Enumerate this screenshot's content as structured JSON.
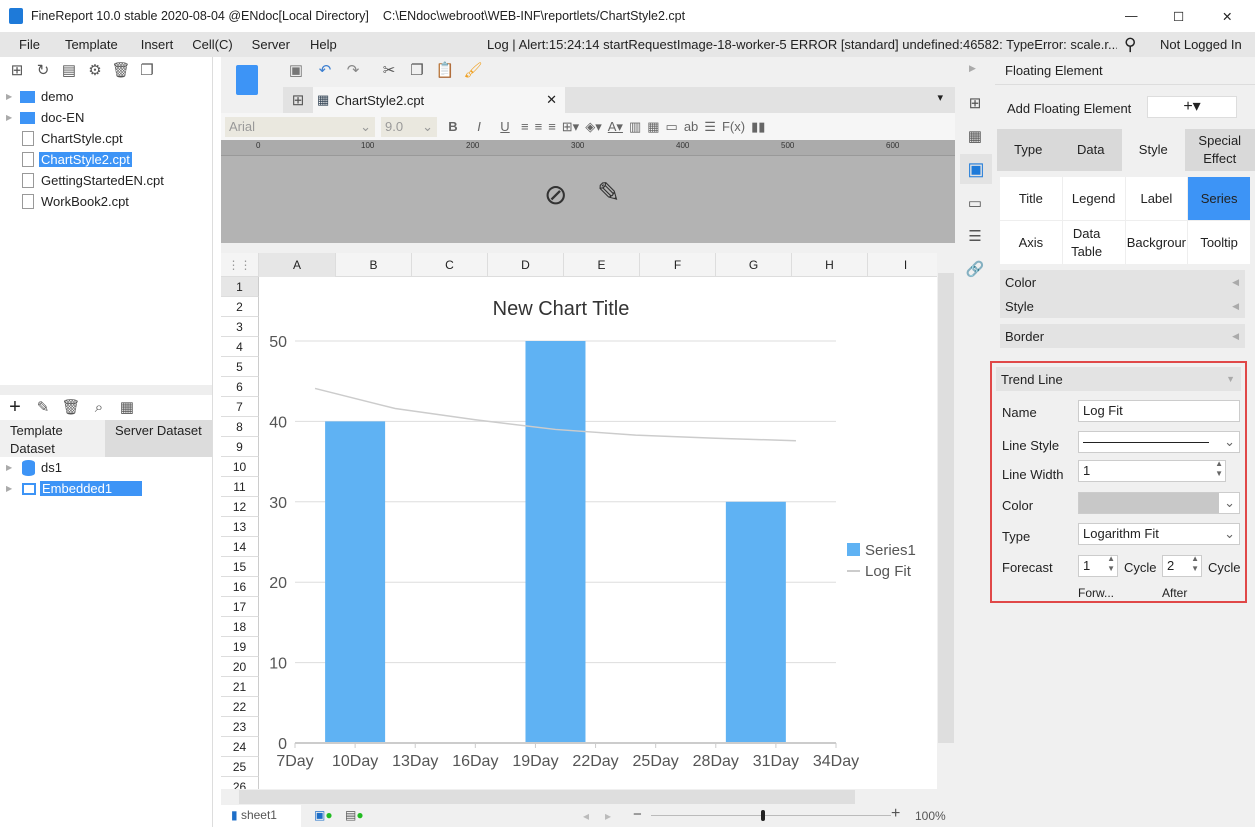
{
  "window": {
    "title": "FineReport 10.0 stable 2020-08-04 @ENdoc[Local Directory]",
    "path": "C:\\ENdoc\\webroot\\WEB-INF\\reportlets/ChartStyle2.cpt",
    "minimize": "—",
    "maximize": "☐",
    "close": "✕"
  },
  "menu": [
    "File",
    "Template",
    "Insert",
    "Cell(C)",
    "Server",
    "Help"
  ],
  "log": "Log | Alert:15:24:14 startRequestImage-18-worker-5 ERROR [standard] undefined:46582: TypeError: scale.r...",
  "login": "Not Logged In",
  "tree": [
    {
      "label": "demo",
      "type": "folder"
    },
    {
      "label": "doc-EN",
      "type": "folder"
    },
    {
      "label": "ChartStyle.cpt",
      "type": "file"
    },
    {
      "label": "ChartStyle2.cpt",
      "type": "file",
      "selected": true
    },
    {
      "label": "GettingStartedEN.cpt",
      "type": "file"
    },
    {
      "label": "WorkBook2.cpt",
      "type": "file"
    }
  ],
  "dataset_tabs": {
    "template": "Template Dataset",
    "server": "Server Dataset"
  },
  "datasets": [
    {
      "label": "ds1"
    },
    {
      "label": "Embedded1",
      "selected": true
    }
  ],
  "file_tab": "ChartStyle2.cpt",
  "format": {
    "font": "Arial",
    "size": "9.0"
  },
  "ruler": [
    "0",
    "100",
    "200",
    "300",
    "400",
    "500",
    "600"
  ],
  "columns": [
    "A",
    "B",
    "C",
    "D",
    "E",
    "F",
    "G",
    "H",
    "I"
  ],
  "rows": [
    "1",
    "2",
    "3",
    "4",
    "5",
    "6",
    "7",
    "8",
    "9",
    "10",
    "11",
    "12",
    "13",
    "14",
    "15",
    "16",
    "17",
    "18",
    "19",
    "20",
    "21",
    "22",
    "23",
    "24",
    "25",
    "26"
  ],
  "sheet": "sheet1",
  "zoom": "100%",
  "zoom_level": 100,
  "chart_data": {
    "type": "bar",
    "title": "New Chart Title",
    "x_ticks": [
      "7Day",
      "10Day",
      "13Day",
      "16Day",
      "19Day",
      "22Day",
      "25Day",
      "28Day",
      "31Day",
      "34Day"
    ],
    "x_range": [
      7,
      34
    ],
    "y_ticks": [
      "0",
      "10",
      "20",
      "30",
      "40",
      "50"
    ],
    "ylim": [
      0,
      50
    ],
    "grid": true,
    "legend_position": "right",
    "series": [
      {
        "name": "Series1",
        "x": [
          10,
          20,
          30
        ],
        "values": [
          40,
          50,
          30
        ],
        "color": "#5fb2f3"
      }
    ],
    "trend_line": {
      "name": "Log Fit",
      "color": "#cccccc",
      "x": [
        8,
        12,
        16,
        20,
        24,
        28,
        32
      ],
      "values": [
        44.1,
        41.6,
        40.2,
        39.0,
        38.3,
        37.9,
        37.6
      ]
    }
  },
  "panel": {
    "header": "Floating Element",
    "add_label": "Add Floating Element",
    "add_btn": "+▾",
    "tabs": [
      "Type",
      "Data",
      "Style",
      "Special Effect"
    ],
    "active_tab": "Style",
    "subtabs": [
      "Title",
      "Legend",
      "Label",
      "Series",
      "Axis",
      "Data Table",
      "Backgrour",
      "Tooltip"
    ],
    "active_subtab": "Series",
    "sections": [
      "Color",
      "Style",
      "Border"
    ],
    "trend": {
      "title": "Trend Line",
      "name_label": "Name",
      "name_value": "Log Fit",
      "line_style_label": "Line Style",
      "line_width_label": "Line Width",
      "line_width_value": "1",
      "color_label": "Color",
      "color_value": "#c8c8c8",
      "type_label": "Type",
      "type_value": "Logarithm Fit",
      "forecast_label": "Forecast",
      "forward_value": "1",
      "cycle1": "Cycle",
      "after_value": "2",
      "cycle2": "Cycle",
      "forward_label": "Forw...",
      "after_label": "After"
    },
    "highlight_color": "#e04848"
  }
}
